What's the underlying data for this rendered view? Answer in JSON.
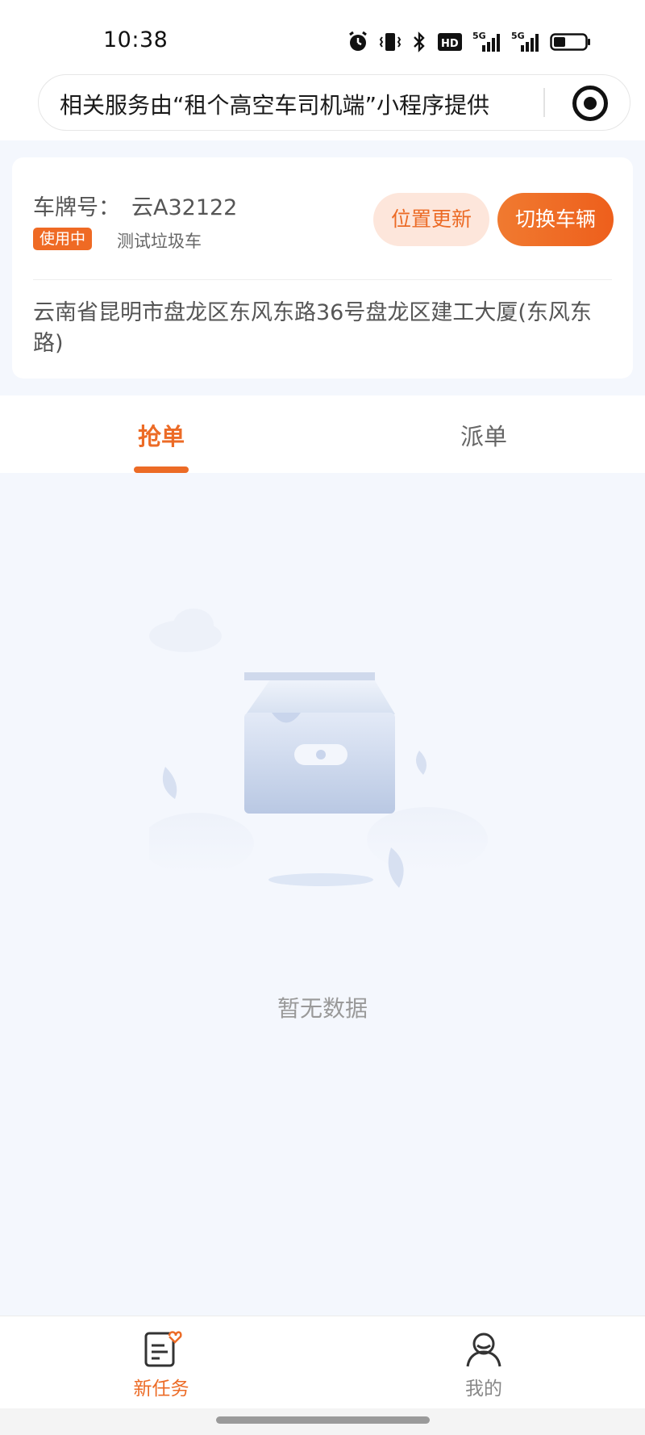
{
  "status_bar": {
    "time": "10:38",
    "icons": [
      "alarm-icon",
      "vibrate-icon",
      "bluetooth-icon",
      "hd-icon",
      "signal-5g-icon",
      "signal-5g-icon-2",
      "battery-icon"
    ],
    "network_label_1": "5G",
    "network_label_2": "5G",
    "hd_label": "HD"
  },
  "notice": {
    "text": "相关服务由“租个高空车司机端”小程序提供"
  },
  "vehicle": {
    "plate_label": "车牌号：",
    "plate_value": "云A32122",
    "status": "使用中",
    "type": "测试垃圾车",
    "update_location_label": "位置更新",
    "switch_vehicle_label": "切换车辆",
    "address": "云南省昆明市盘龙区东风东路36号盘龙区建工大厦(东风东路)"
  },
  "tabs": [
    {
      "label": "抢单",
      "active": true
    },
    {
      "label": "派单",
      "active": false
    }
  ],
  "empty_state": {
    "message": "暂无数据"
  },
  "bottom_nav": [
    {
      "label": "新任务",
      "icon": "task-list-icon",
      "active": true
    },
    {
      "label": "我的",
      "icon": "user-icon",
      "active": false
    }
  ],
  "colors": {
    "accent": "#ec6b26",
    "accent_light": "#fde6db",
    "page_bg": "#f4f7fd"
  }
}
